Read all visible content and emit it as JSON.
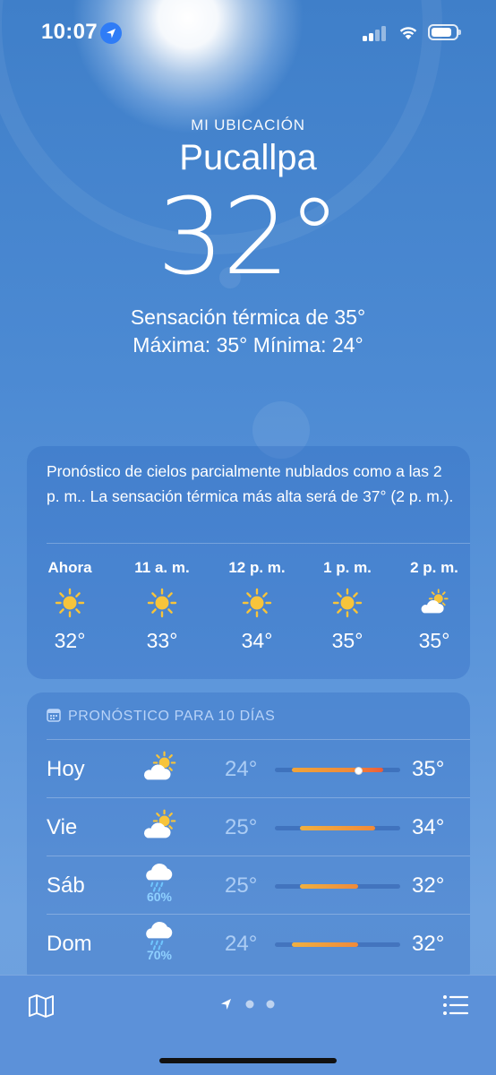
{
  "status_bar": {
    "time": "10:07",
    "battery_level": 0.85
  },
  "location": {
    "label": "MI UBICACIÓN",
    "city": "Pucallpa",
    "temperature": "32°",
    "feels_like": "Sensación térmica de 35°",
    "high_low": "Máxima: 35°  Mínima: 24°"
  },
  "hourly": {
    "summary": "Pronóstico de cielos parcialmente nublados como a las 2 p. m.. La sensación térmica más alta será de 37° (2 p. m.).",
    "items": [
      {
        "time": "Ahora",
        "icon": "sun-icon",
        "temp": "32°"
      },
      {
        "time": "11 a. m.",
        "icon": "sun-icon",
        "temp": "33°"
      },
      {
        "time": "12 p. m.",
        "icon": "sun-icon",
        "temp": "34°"
      },
      {
        "time": "1 p. m.",
        "icon": "sun-icon",
        "temp": "35°"
      },
      {
        "time": "2 p. m.",
        "icon": "partly-cloudy-icon",
        "temp": "35°"
      }
    ]
  },
  "daily": {
    "title": "PRONÓSTICO PARA 10 DÍAS",
    "range_min": 22,
    "range_max": 37,
    "current_temp": 32,
    "items": [
      {
        "day": "Hoy",
        "icon": "partly-cloudy-icon",
        "precip": "",
        "low": "24°",
        "high": "35°",
        "low_val": 24,
        "high_val": 35,
        "show_current": true
      },
      {
        "day": "Vie",
        "icon": "partly-cloudy-icon",
        "precip": "",
        "low": "25°",
        "high": "34°",
        "low_val": 25,
        "high_val": 34,
        "show_current": false
      },
      {
        "day": "Sáb",
        "icon": "rain-icon",
        "precip": "60%",
        "low": "25°",
        "high": "32°",
        "low_val": 25,
        "high_val": 32,
        "show_current": false
      },
      {
        "day": "Dom",
        "icon": "rain-icon",
        "precip": "70%",
        "low": "24°",
        "high": "32°",
        "low_val": 24,
        "high_val": 32,
        "show_current": false
      }
    ]
  },
  "bottom_bar": {
    "map_icon": "map-icon",
    "list_icon": "list-icon",
    "pages": 3
  }
}
